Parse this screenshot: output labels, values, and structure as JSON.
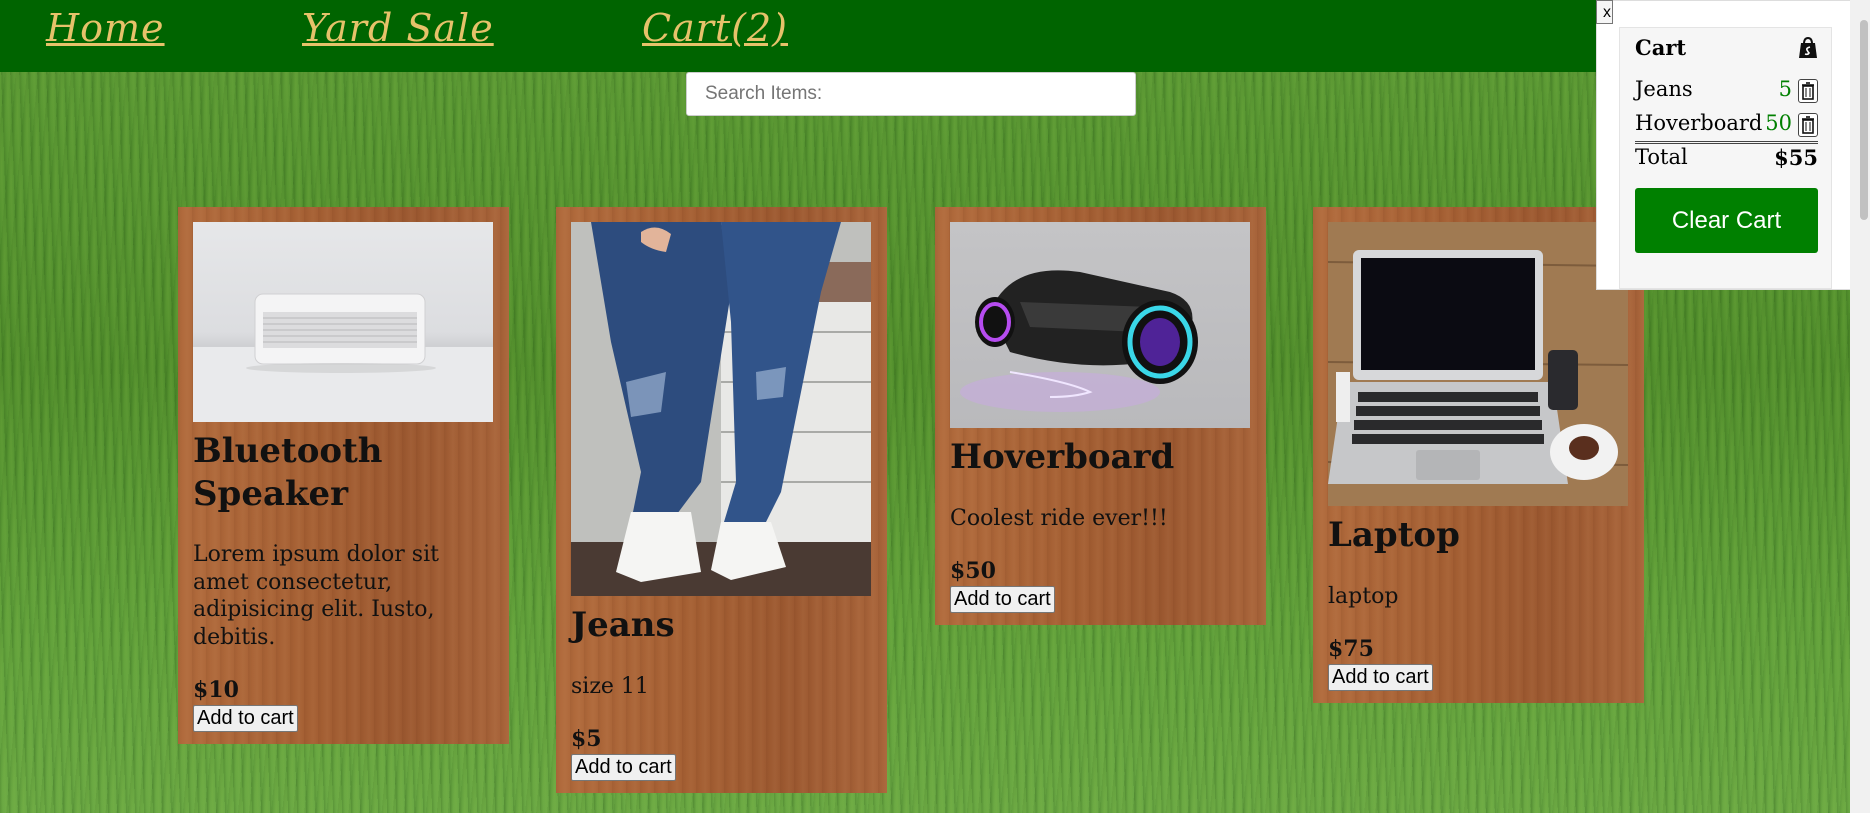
{
  "nav": {
    "home": "Home",
    "yard_sale": "Yard Sale",
    "cart": "Cart(2)"
  },
  "search": {
    "placeholder": "Search Items:"
  },
  "products": [
    {
      "name": "Bluetooth Speaker",
      "description": "Lorem ipsum dolor sit amet consectetur, adipisicing elit. Iusto, debitis.",
      "price": "$10",
      "button": "Add to cart",
      "image": "white-speaker"
    },
    {
      "name": "Jeans",
      "description": "size 11",
      "price": "$5",
      "button": "Add to cart",
      "image": "jeans-sneakers"
    },
    {
      "name": "Hoverboard",
      "description": "Coolest ride ever!!!",
      "price": "$50",
      "button": "Add to cart",
      "image": "hoverboard"
    },
    {
      "name": "Laptop",
      "description": "laptop",
      "price": "$75",
      "button": "Add to cart",
      "image": "laptop-desk"
    }
  ],
  "cart": {
    "close": "x",
    "title": "Cart",
    "items": [
      {
        "name": "Jeans",
        "qty": "5"
      },
      {
        "name": "Hoverboard",
        "qty": "50"
      }
    ],
    "total_label": "Total",
    "total_value": "$55",
    "clear_button": "Clear Cart"
  },
  "colors": {
    "nav_bg": "#006400",
    "nav_link": "#e6c26a",
    "clear_button": "#008000",
    "qty": "#008000"
  }
}
